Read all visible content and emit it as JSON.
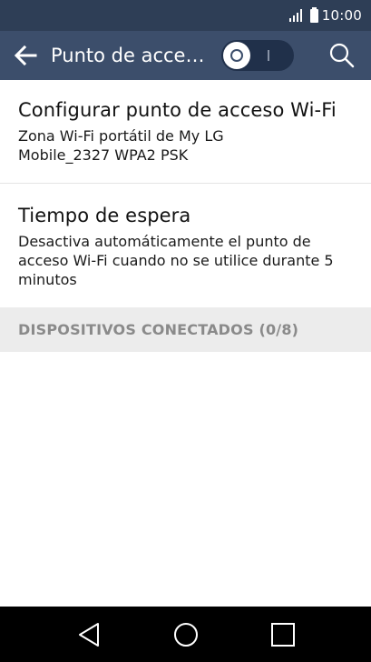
{
  "status_bar": {
    "time": "10:00",
    "signal_icon": "signal-icon",
    "battery_icon": "battery-icon"
  },
  "action_bar": {
    "back_icon": "arrow-left-icon",
    "title": "Punto de acceso Wi-Fi",
    "toggle_state": "off",
    "search_icon": "search-icon"
  },
  "settings": [
    {
      "title": "Configurar punto de acceso Wi-Fi",
      "summary": "Zona Wi-Fi portátil de My LG Mobile_2327 WPA2 PSK"
    },
    {
      "title": "Tiempo de espera",
      "summary": "Desactiva automáticamente el punto de acceso Wi-Fi cuando no se utilice durante 5 minutos"
    }
  ],
  "section": {
    "label": "DISPOSITIVOS CONECTADOS (0/8)"
  },
  "nav_bar": {
    "back_icon": "triangle-back-icon",
    "home_icon": "circle-home-icon",
    "recents_icon": "square-recents-icon"
  },
  "colors": {
    "status_bar": "#2e3e56",
    "action_bar": "#3c4e6b",
    "section_header": "#ececec",
    "nav_bar": "#000000"
  }
}
